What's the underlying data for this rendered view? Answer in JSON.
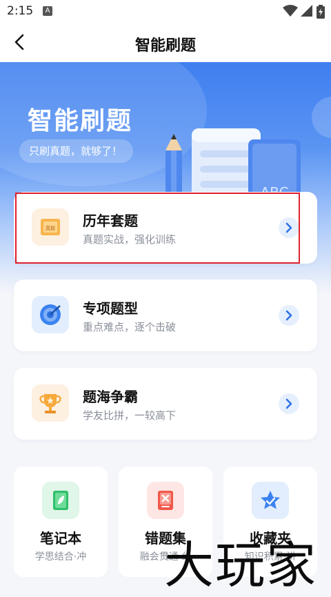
{
  "status_bar": {
    "time": "2:15",
    "notification_icon": "A"
  },
  "navbar": {
    "title": "智能刷题"
  },
  "hero": {
    "title": "智能刷题",
    "slogan": "只刷真题，就够了！",
    "illustration_text": "ABC"
  },
  "cards": [
    {
      "title": "历年套题",
      "subtitle": "真题实战，强化训练",
      "icon_label": "真题"
    },
    {
      "title": "专项题型",
      "subtitle": "重点难点，逐个击破"
    },
    {
      "title": "题海争霸",
      "subtitle": "学友比拼，一较高下"
    }
  ],
  "tiles": [
    {
      "title": "笔记本",
      "subtitle": "学思结合·冲"
    },
    {
      "title": "错题集",
      "subtitle": "融会贯通·纟"
    },
    {
      "title": "收藏夹",
      "subtitle": "知识积累·讲"
    }
  ],
  "watermark": "大玩家",
  "colors": {
    "brand_blue": "#3f7ff0",
    "highlight_red": "#e0202c"
  }
}
